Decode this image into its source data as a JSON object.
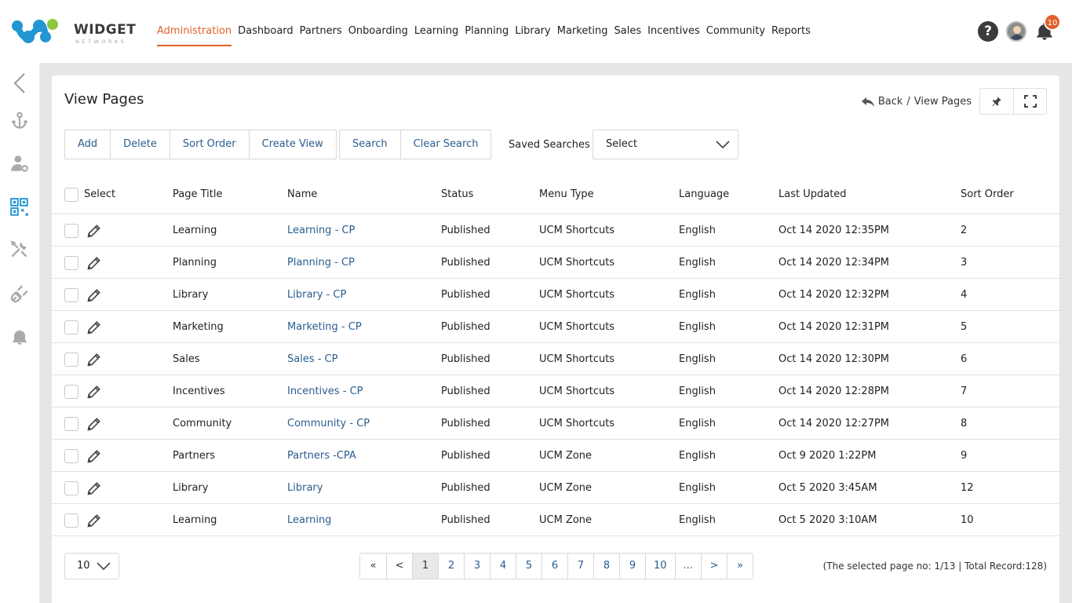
{
  "brand": {
    "name": "WIDGET",
    "tagline": "NETWORKS"
  },
  "nav": [
    {
      "label": "Administration",
      "active": true
    },
    {
      "label": "Dashboard"
    },
    {
      "label": "Partners"
    },
    {
      "label": "Onboarding"
    },
    {
      "label": "Learning"
    },
    {
      "label": "Planning"
    },
    {
      "label": "Library"
    },
    {
      "label": "Marketing"
    },
    {
      "label": "Sales"
    },
    {
      "label": "Incentives"
    },
    {
      "label": "Community"
    },
    {
      "label": "Reports"
    }
  ],
  "header": {
    "help_glyph": "?",
    "notification_count": "10"
  },
  "page": {
    "title": "View Pages"
  },
  "breadcrumb": {
    "back": "Back",
    "separator": "/",
    "current": "View Pages"
  },
  "toolbar": {
    "actions": [
      "Add",
      "Delete",
      "Sort Order",
      "Create View"
    ],
    "search": [
      "Search",
      "Clear Search"
    ],
    "saved_searches_label": "Saved Searches",
    "saved_searches_value": "Select"
  },
  "table": {
    "headers": {
      "select": "Select",
      "page_title": "Page Title",
      "name": "Name",
      "status": "Status",
      "menu_type": "Menu Type",
      "language": "Language",
      "last_updated": "Last Updated",
      "sort_order": "Sort Order"
    },
    "rows": [
      {
        "page_title": "Learning",
        "name": "Learning - CP",
        "status": "Published",
        "menu_type": "UCM Shortcuts",
        "language": "English",
        "last_updated": "Oct 14 2020 12:35PM",
        "sort_order": "2"
      },
      {
        "page_title": "Planning",
        "name": "Planning - CP",
        "status": "Published",
        "menu_type": "UCM Shortcuts",
        "language": "English",
        "last_updated": "Oct 14 2020 12:34PM",
        "sort_order": "3"
      },
      {
        "page_title": "Library",
        "name": "Library - CP",
        "status": "Published",
        "menu_type": "UCM Shortcuts",
        "language": "English",
        "last_updated": "Oct 14 2020 12:32PM",
        "sort_order": "4"
      },
      {
        "page_title": "Marketing",
        "name": "Marketing - CP",
        "status": "Published",
        "menu_type": "UCM Shortcuts",
        "language": "English",
        "last_updated": "Oct 14 2020 12:31PM",
        "sort_order": "5"
      },
      {
        "page_title": "Sales",
        "name": "Sales - CP",
        "status": "Published",
        "menu_type": "UCM Shortcuts",
        "language": "English",
        "last_updated": "Oct 14 2020 12:30PM",
        "sort_order": "6"
      },
      {
        "page_title": "Incentives",
        "name": "Incentives - CP",
        "status": "Published",
        "menu_type": "UCM Shortcuts",
        "language": "English",
        "last_updated": "Oct 14 2020 12:28PM",
        "sort_order": "7"
      },
      {
        "page_title": "Community",
        "name": "Community - CP",
        "status": "Published",
        "menu_type": "UCM Shortcuts",
        "language": "English",
        "last_updated": "Oct 14 2020 12:27PM",
        "sort_order": "8"
      },
      {
        "page_title": "Partners",
        "name": "Partners -CPA",
        "status": "Published",
        "menu_type": "UCM Zone",
        "language": "English",
        "last_updated": "Oct 9 2020 1:22PM",
        "sort_order": "9"
      },
      {
        "page_title": "Library",
        "name": "Library",
        "status": "Published",
        "menu_type": "UCM Zone",
        "language": "English",
        "last_updated": "Oct 5 2020 3:45AM",
        "sort_order": "12"
      },
      {
        "page_title": "Learning",
        "name": "Learning",
        "status": "Published",
        "menu_type": "UCM Zone",
        "language": "English",
        "last_updated": "Oct 5 2020 3:10AM",
        "sort_order": "10"
      }
    ]
  },
  "pagination": {
    "page_size": "10",
    "first": "«",
    "prev": "<",
    "pages": [
      "1",
      "2",
      "3",
      "4",
      "5",
      "6",
      "7",
      "8",
      "9",
      "10",
      "..."
    ],
    "current": "1",
    "next": ">",
    "last": "»",
    "info": "(The selected page no: 1/13 | Total Record:128)"
  },
  "colors": {
    "accent": "#e0612a",
    "link": "#2a5d8f",
    "logo_blue": "#2196d3",
    "logo_green": "#8dc63f"
  }
}
